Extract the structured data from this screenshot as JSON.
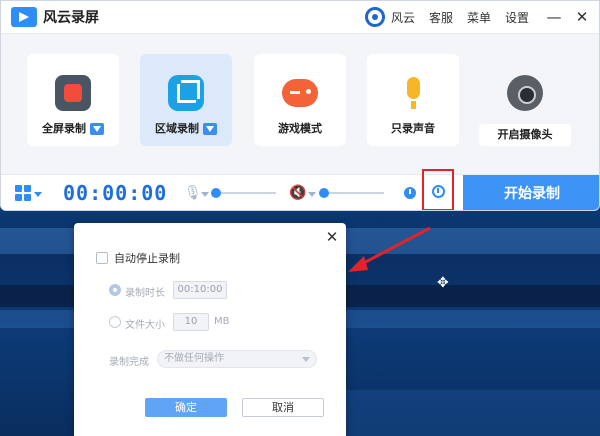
{
  "app": {
    "title": "风云录屏",
    "brand_link": "风云",
    "service_link": "客服",
    "menu_link": "菜单",
    "settings_link": "设置",
    "minimize_glyph": "—",
    "close_glyph": "✕"
  },
  "modes": [
    {
      "label": "全屏录制",
      "icon": "fullscreen-record-icon",
      "has_dropdown": true
    },
    {
      "label": "区域录制",
      "icon": "region-crop-icon",
      "has_dropdown": true,
      "active": true
    },
    {
      "label": "游戏模式",
      "icon": "gamepad-icon",
      "has_dropdown": false
    },
    {
      "label": "只录声音",
      "icon": "microphone-icon",
      "has_dropdown": false
    },
    {
      "label": "开启摄像头",
      "icon": "webcam-icon",
      "has_dropdown": false
    }
  ],
  "toolbar": {
    "timer": "00:00:00",
    "start_label": "开始录制",
    "mic_glyph": "🎙",
    "speaker_glyph": "🔇"
  },
  "dialog": {
    "close_glyph": "✕",
    "auto_stop_label": "自动停止录制",
    "duration_label": "录制时长",
    "duration_value": "00:10:00",
    "filesize_label": "文件大小",
    "filesize_value": "10",
    "filesize_unit": "MB",
    "on_complete_label": "录制完成",
    "on_complete_value": "不做任何操作",
    "ok_label": "确定",
    "cancel_label": "取消"
  },
  "colors": {
    "accent": "#3d93f5",
    "highlight_box": "#e3232a",
    "arrow": "#e3232a"
  }
}
